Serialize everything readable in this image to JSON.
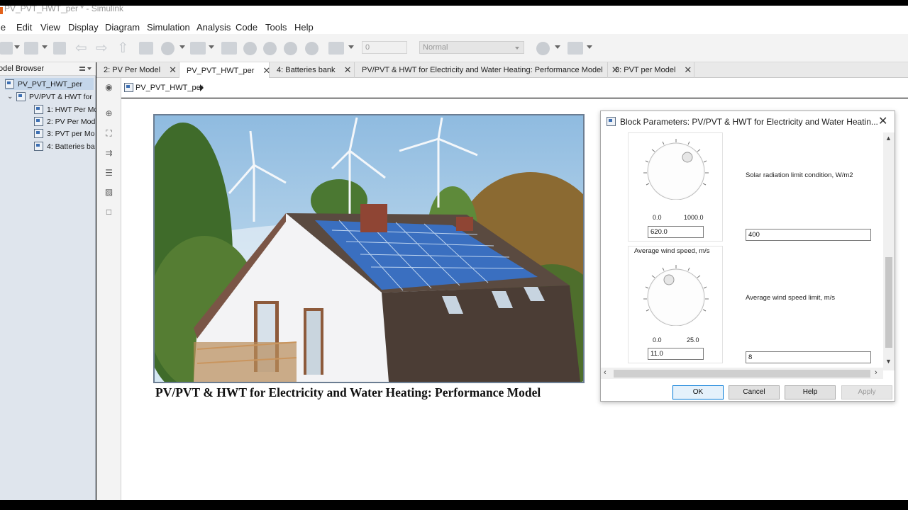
{
  "window": {
    "title": "PV_PVT_HWT_per * - Simulink"
  },
  "menu": [
    "le",
    "Edit",
    "View",
    "Display",
    "Diagram",
    "Simulation",
    "Analysis",
    "Code",
    "Tools",
    "Help"
  ],
  "toolbar": {
    "stop_time": "0",
    "sim_mode": "Normal"
  },
  "browser": {
    "title": "odel Browser",
    "items": [
      {
        "label": "PV_PVT_HWT_per",
        "level": 0
      },
      {
        "label": "PV/PVT & HWT for",
        "level": 1
      },
      {
        "label": "1: HWT Per Mo",
        "level": 2
      },
      {
        "label": "2: PV Per Mod",
        "level": 2
      },
      {
        "label": "3: PVT per Mo",
        "level": 2
      },
      {
        "label": "4: Batteries ba",
        "level": 2
      }
    ]
  },
  "tabs": [
    {
      "label": "2: PV Per Model",
      "active": false
    },
    {
      "label": "PV_PVT_HWT_per",
      "active": true
    },
    {
      "label": "4: Batteries bank",
      "active": false
    },
    {
      "label": "PV/PVT & HWT for Electricity and Water Heating: Performance Model",
      "active": false
    },
    {
      "label": "3: PVT per Model",
      "active": false
    }
  ],
  "breadcrumb": "PV_PVT_HWT_per",
  "canvas": {
    "caption": "PV/PVT & HWT for Electricity and Water Heating: Performance Model"
  },
  "dialog": {
    "title": "Block Parameters: PV/PVT & HWT for Electricity and Water Heatin...",
    "knob1": {
      "min": "0.0",
      "max": "1000.0",
      "value": "620.0"
    },
    "param1": {
      "label": "Solar radiation limit condition, W/m2",
      "value": "400"
    },
    "knob2": {
      "title": "Average wind speed, m/s",
      "min": "0.0",
      "max": "25.0",
      "value": "11.0"
    },
    "param2": {
      "label": "Average wind speed limit, m/s",
      "value": "8"
    },
    "buttons": {
      "ok": "OK",
      "cancel": "Cancel",
      "help": "Help",
      "apply": "Apply"
    }
  },
  "colors": {
    "accent": "#0078d7",
    "browser_bg": "#dfe5ed",
    "selected": "#c4d6ea"
  },
  "icons": [
    "model-icon",
    "zoom-icon",
    "fit-icon",
    "arrow-icon",
    "annotation-icon",
    "image-icon",
    "area-icon",
    "close-icon"
  ]
}
